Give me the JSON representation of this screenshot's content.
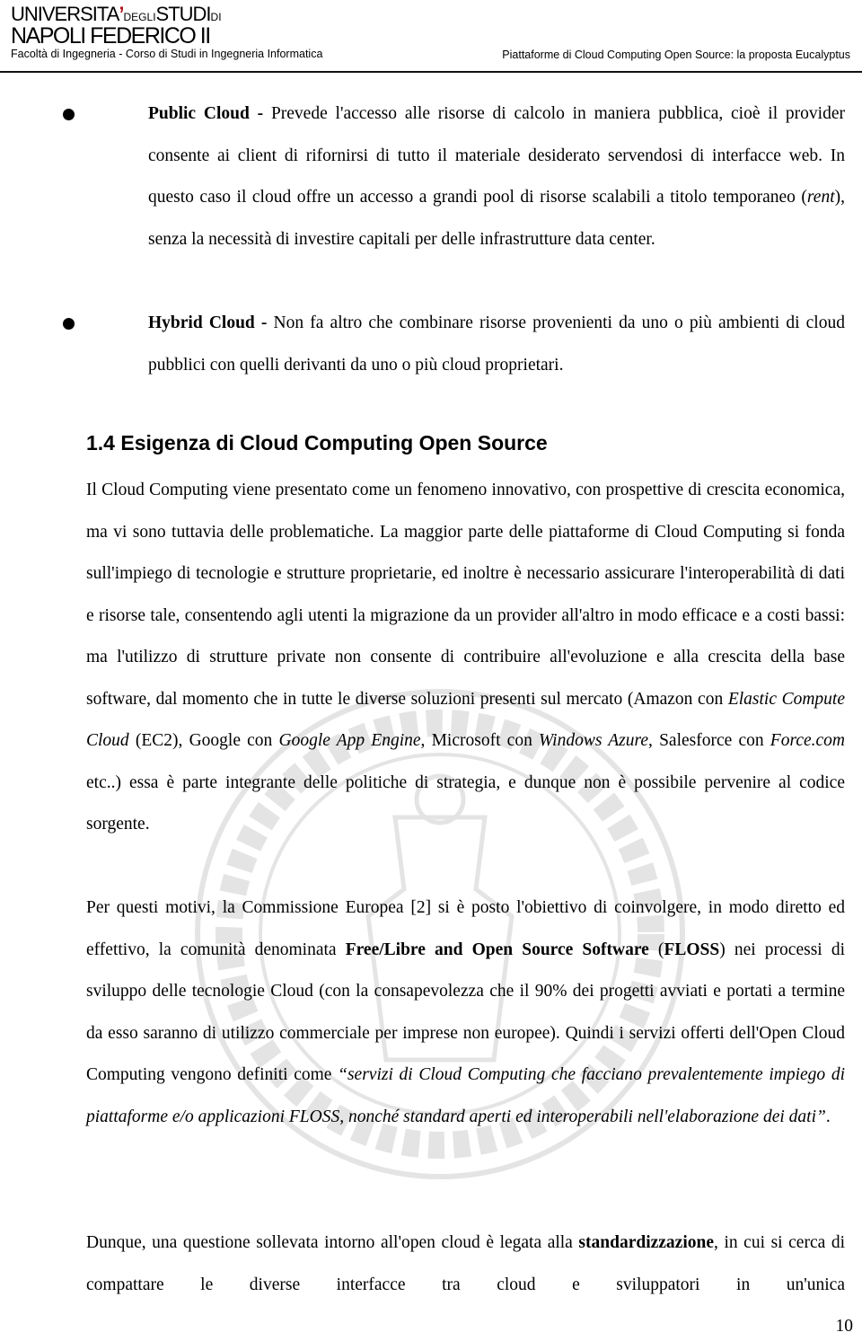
{
  "header": {
    "university_line1_main": "UNIVERSITA",
    "university_line1_apos": "’",
    "university_line1_small": "DEGLI",
    "university_line1_studi": "STUDI",
    "university_line1_di": "DI",
    "university_line2": "NAPOLI FEDERICO II",
    "faculty": "Facoltà di Ingegneria - Corso di Studi in Ingegneria Informatica",
    "document_title": "Piattaforme di Cloud Computing Open Source: la proposta Eucalyptus"
  },
  "bullets": [
    {
      "term": "Public Cloud -",
      "text_before_italic": " Prevede l'accesso alle risorse di calcolo in maniera pubblica, cioè il provider consente ai client di rifornirsi di tutto il materiale desiderato servendosi di interfacce web. In questo caso il cloud offre un accesso a grandi pool di risorse scalabili a titolo temporaneo (",
      "italic": "rent",
      "text_after_italic": "), senza la necessità di investire capitali per delle infrastrutture data center."
    },
    {
      "term": "Hybrid Cloud -",
      "text": " Non fa altro che combinare risorse provenienti da uno o più ambienti di cloud pubblici con quelli derivanti da uno o più cloud proprietari."
    }
  ],
  "section": {
    "heading": "1.4 Esigenza di Cloud Computing Open Source",
    "paragraph1": {
      "p1": "Il Cloud Computing viene presentato come un fenomeno innovativo, con prospettive di crescita economica, ma vi sono tuttavia delle problematiche. La maggior parte delle piattaforme di Cloud Computing si fonda sull'impiego di tecnologie e strutture proprietarie, ed inoltre è necessario assicurare l'interoperabilità di dati e risorse tale, consentendo agli utenti la migrazione da un provider all'altro in modo efficace e a costi bassi: ma l'utilizzo di strutture private non consente di contribuire all'evoluzione e alla crescita della base software, dal momento che in tutte le diverse soluzioni presenti sul mercato (Amazon con ",
      "i1": "Elastic Compute Cloud",
      "p2": " (EC2), Google con ",
      "i2": "Google App Engine",
      "p3": ", Microsoft con ",
      "i3": "Windows Azure",
      "p4": ", Salesforce con ",
      "i4": "Force.com",
      "p5": " etc..) essa è parte integrante delle politiche di strategia, e dunque non è possibile pervenire al codice sorgente."
    },
    "paragraph2": {
      "p1": "Per questi motivi, la Commissione Europea [2] si è posto l'obiettivo di coinvolgere, in modo diretto ed effettivo, la comunità denominata ",
      "b1": "Free/Libre and Open Source Software",
      "p2": " (",
      "b2": "FLOSS",
      "p3": ") nei processi di sviluppo delle tecnologie Cloud (con la consapevolezza che il 90% dei progetti avviati e portati a termine da esso saranno di utilizzo commerciale per imprese non europee). Quindi i servizi offerti dell'Open Cloud Computing vengono definiti come ",
      "quote": "“servizi di Cloud Computing che facciano prevalentemente impiego di piattaforme e/o applicazioni FLOSS, nonché standard aperti ed interoperabili nell'elaborazione dei dati”",
      "p4": "."
    },
    "paragraph3": {
      "p1": "Dunque, una questione sollevata intorno all'open cloud è legata alla ",
      "b1": "standardizzazione",
      "p2": ", in cui si cerca di compattare le diverse interfacce tra cloud e sviluppatori in un'unica"
    }
  },
  "footer": {
    "page_number": "10"
  }
}
